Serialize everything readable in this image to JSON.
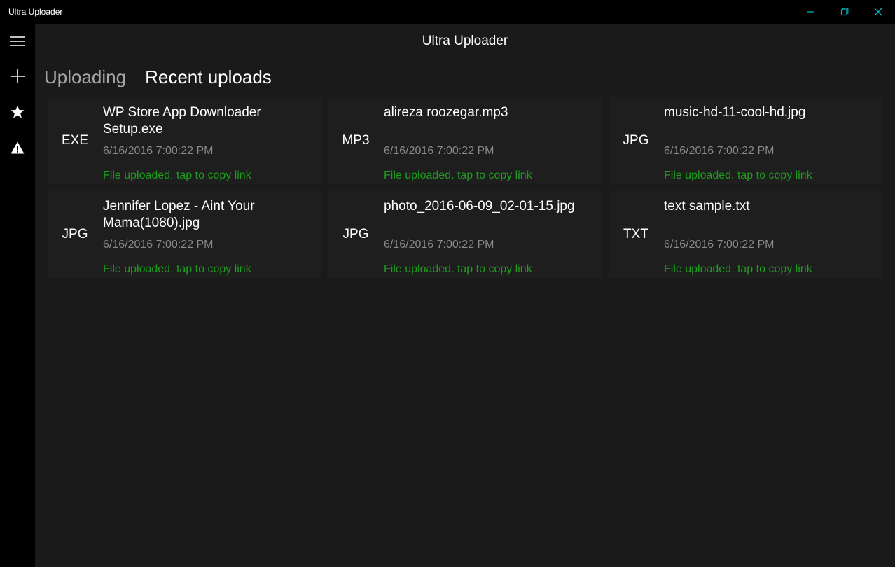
{
  "window": {
    "title": "Ultra Uploader",
    "controls": [
      "minimize-icon",
      "restore-icon",
      "close-icon"
    ]
  },
  "rail": {
    "items": [
      {
        "icon": "hamburger-menu-icon"
      },
      {
        "icon": "plus-icon"
      },
      {
        "icon": "star-icon"
      },
      {
        "icon": "warning-icon"
      }
    ]
  },
  "header": {
    "title": "Ultra Uploader"
  },
  "tabs": [
    {
      "label": "Uploading",
      "active": false
    },
    {
      "label": "Recent uploads",
      "active": true
    }
  ],
  "uploads": [
    {
      "ext": "EXE",
      "name": "WP Store App Downloader Setup.exe",
      "date": "6/16/2016 7:00:22 PM",
      "status": "File uploaded. tap to copy link"
    },
    {
      "ext": "MP3",
      "name": "alireza roozegar.mp3",
      "date": "6/16/2016 7:00:22 PM",
      "status": "File uploaded. tap to copy link"
    },
    {
      "ext": "JPG",
      "name": "music-hd-11-cool-hd.jpg",
      "date": "6/16/2016 7:00:22 PM",
      "status": "File uploaded. tap to copy link"
    },
    {
      "ext": "JPG",
      "name": "Jennifer Lopez - Aint Your Mama(1080).jpg",
      "date": "6/16/2016 7:00:22 PM",
      "status": "File uploaded. tap to copy link"
    },
    {
      "ext": "JPG",
      "name": "photo_2016-06-09_02-01-15.jpg",
      "date": "6/16/2016 7:00:22 PM",
      "status": "File uploaded. tap to copy link"
    },
    {
      "ext": "TXT",
      "name": "text sample.txt",
      "date": "6/16/2016 7:00:22 PM",
      "status": "File uploaded. tap to copy link"
    }
  ],
  "colors": {
    "titlebar_bg": "#000000",
    "rail_bg": "#000000",
    "content_bg": "#1a1a1a",
    "card_bg": "#1e1e1e",
    "status_green": "#1f9d1f",
    "window_control_accent": "#00b7c3"
  }
}
